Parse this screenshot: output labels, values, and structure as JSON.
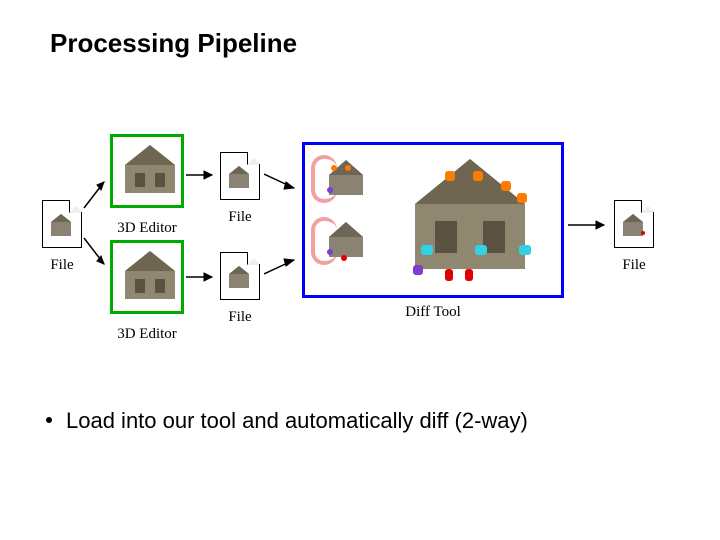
{
  "title": "Processing Pipeline",
  "bullet_text": "Load into our tool and automatically diff (2-way)",
  "labels": {
    "file_in": "File",
    "editor_top": "3D Editor",
    "editor_bottom": "3D Editor",
    "file_top": "File",
    "file_bottom": "File",
    "diff_tool": "Diff Tool",
    "file_out": "File"
  },
  "diff_markers": {
    "top_house": [
      "orange",
      "orange",
      "orange",
      "orange"
    ],
    "bottom_house": [
      "purple",
      "purple",
      "red"
    ],
    "large_house": [
      "orange",
      "orange",
      "orange",
      "orange",
      "cyan",
      "cyan",
      "cyan",
      "red",
      "red",
      "purple"
    ]
  },
  "colors": {
    "editor_border": "#00aa00",
    "diff_border": "#0000ff",
    "bracket": "#f2a0a0"
  }
}
